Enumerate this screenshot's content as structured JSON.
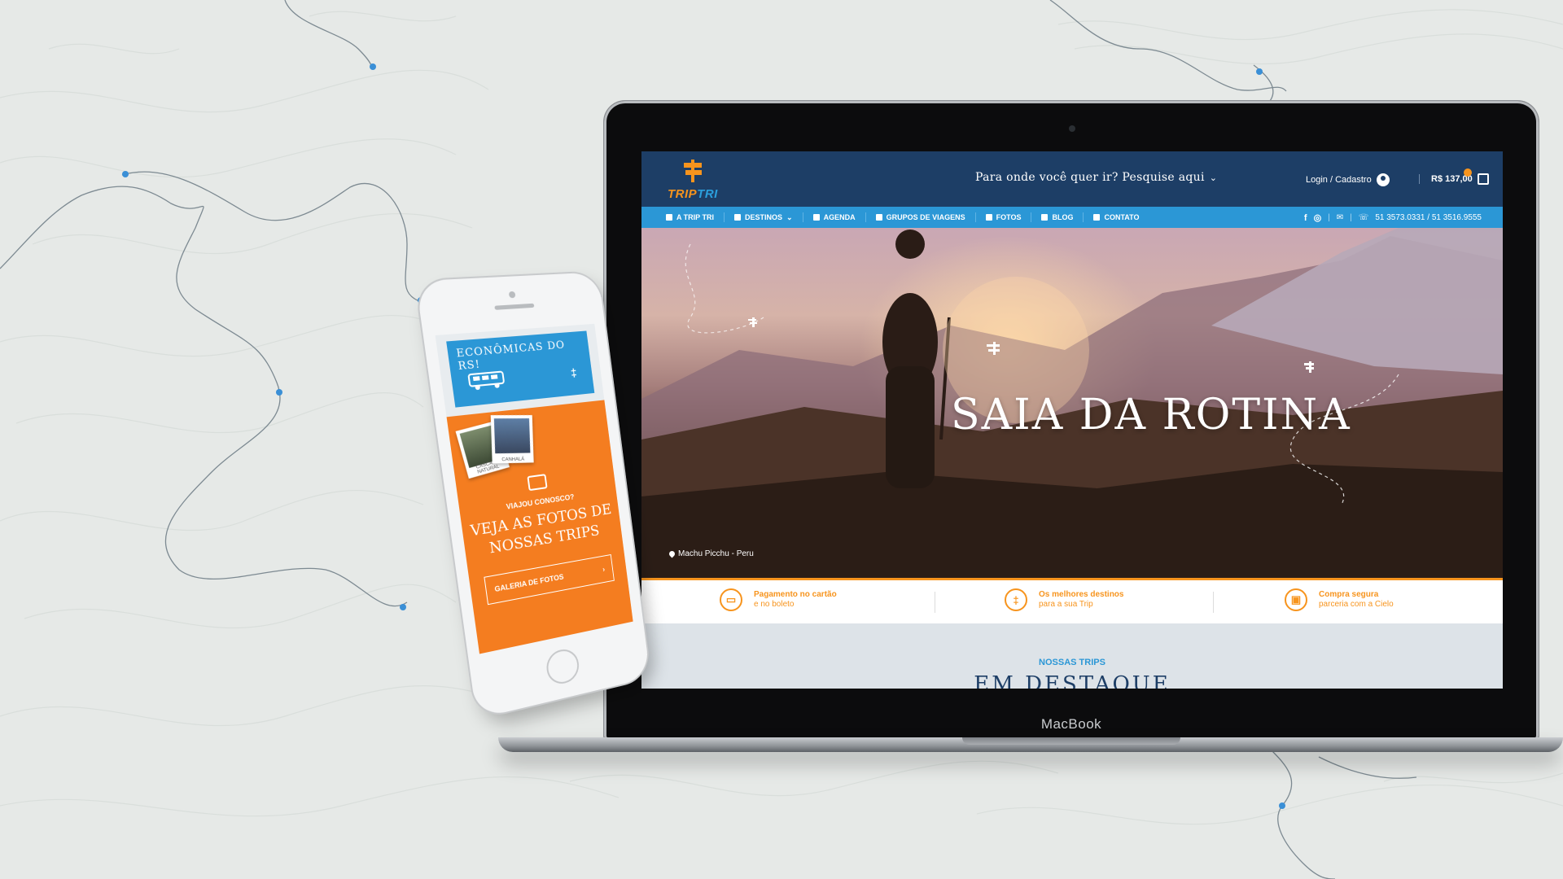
{
  "laptop": {
    "brand": "MacBook"
  },
  "site": {
    "logo": {
      "part1": "TRIP",
      "part2": "TRI"
    },
    "search_cta": "Para onde você quer ir? Pesquise aqui",
    "login_label": "Login / Cadastro",
    "cart_total": "R$ 137,00",
    "nav": [
      {
        "label": "A Trip Tri",
        "icon": "signpost-icon"
      },
      {
        "label": "Destinos",
        "icon": "pin-icon",
        "dropdown": true
      },
      {
        "label": "Agenda",
        "icon": "calendar-icon"
      },
      {
        "label": "Grupos de viagens",
        "icon": "group-icon"
      },
      {
        "label": "Fotos",
        "icon": "camera-icon"
      },
      {
        "label": "Blog",
        "icon": "chat-icon"
      },
      {
        "label": "Contato",
        "icon": "message-icon"
      }
    ],
    "social": {
      "facebook": "f",
      "instagram": "◎"
    },
    "phones": "51 3573.0331 / 51 3516.9555",
    "hero": {
      "title": "SAIA DA ROTINA",
      "location": "Machu Picchu - Peru"
    },
    "features": [
      {
        "title": "Pagamento no cartão",
        "subtitle": "e no boleto",
        "icon": "card-icon"
      },
      {
        "title": "Os melhores destinos",
        "subtitle": "para a sua Trip",
        "icon": "signpost-icon"
      },
      {
        "title": "Compra segura",
        "subtitle": "parceria com a Cielo",
        "icon": "lock-icon"
      }
    ],
    "section": {
      "eyebrow": "NOSSAS TRIPS",
      "title": "EM DESTAQUE"
    },
    "colors": {
      "navy": "#1d3e66",
      "blue": "#2b97d6",
      "orange": "#f7941d"
    }
  },
  "phone": {
    "banner_title": "ECONÔMICAS DO RS!",
    "photo_captions": [
      "CASCATA NATURAL",
      "CANHALÁ"
    ],
    "eyebrow": "VIAJOU CONOSCO?",
    "headline_line1": "VEJA AS FOTOS DE",
    "headline_line2": "NOSSAS TRIPS",
    "button_label": "GALERIA DE FOTOS",
    "button_arrow": "›"
  }
}
